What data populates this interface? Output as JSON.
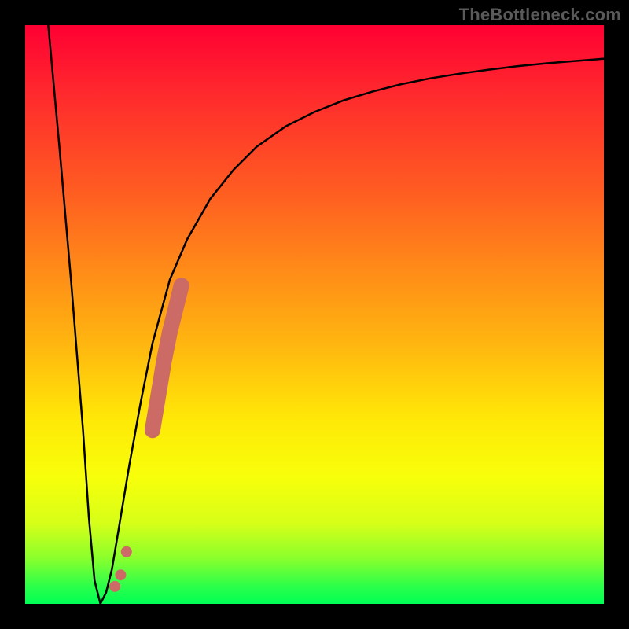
{
  "watermark": "TheBottleneck.com",
  "chart_data": {
    "type": "line",
    "title": "",
    "xlabel": "",
    "ylabel": "",
    "xlim": [
      0,
      100
    ],
    "ylim": [
      0,
      100
    ],
    "grid": false,
    "legend": false,
    "series": [
      {
        "name": "bottleneck-curve",
        "x": [
          4,
          6,
          8,
          10,
          11,
          12,
          13,
          14,
          15,
          16,
          18,
          20,
          22,
          25,
          28,
          32,
          36,
          40,
          45,
          50,
          55,
          60,
          65,
          70,
          75,
          80,
          85,
          90,
          95,
          100
        ],
        "y": [
          100,
          78,
          55,
          30,
          15,
          4,
          0,
          2,
          6,
          12,
          24,
          35,
          45,
          56,
          63,
          70,
          75,
          79,
          82.5,
          85,
          87,
          88.5,
          89.8,
          90.8,
          91.6,
          92.3,
          92.9,
          93.4,
          93.8,
          94.2
        ],
        "color": "#000000",
        "stroke_width": 2.5
      }
    ],
    "scatter": [
      {
        "name": "highlight-dots",
        "points": [
          {
            "x": 15.5,
            "y": 3
          },
          {
            "x": 16.5,
            "y": 5
          },
          {
            "x": 17.5,
            "y": 9
          },
          {
            "x": 22.0,
            "y": 30
          },
          {
            "x": 22.5,
            "y": 33
          },
          {
            "x": 23.0,
            "y": 36
          },
          {
            "x": 23.5,
            "y": 39
          },
          {
            "x": 24.0,
            "y": 42
          },
          {
            "x": 24.5,
            "y": 44.5
          },
          {
            "x": 25.0,
            "y": 47
          },
          {
            "x": 25.5,
            "y": 49
          },
          {
            "x": 26.0,
            "y": 51
          },
          {
            "x": 26.5,
            "y": 53
          },
          {
            "x": 27.0,
            "y": 55
          }
        ],
        "color": "#cc6b66",
        "radius": 10
      }
    ]
  }
}
